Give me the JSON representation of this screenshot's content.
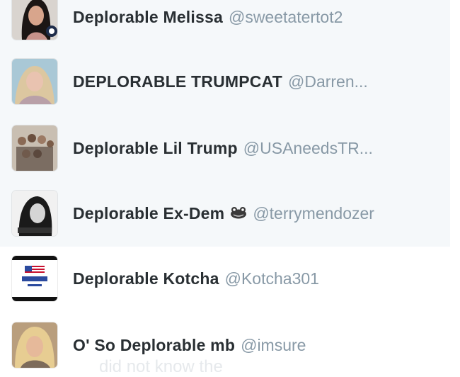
{
  "accounts": [
    {
      "name": "Deplorable Melissa",
      "handle": "@sweetatertot2",
      "avatar": "portrait-dark-hair-avatar"
    },
    {
      "name": "DEPLORABLE TRUMPCAT",
      "handle": "@Darren...",
      "avatar": "portrait-blonde-avatar"
    },
    {
      "name": "Deplorable Lil Trump",
      "handle": "@USAneedsTR...",
      "avatar": "family-group-avatar"
    },
    {
      "name": "Deplorable Ex-Dem",
      "handle": "@terrymendozer",
      "emoji": "frog-icon",
      "avatar": "portrait-bw-avatar"
    },
    {
      "name": "Deplorable Kotcha",
      "handle": "@Kotcha301",
      "avatar": "trump-logo-avatar"
    },
    {
      "name": "O' So Deplorable mb",
      "handle": "@imsure",
      "avatar": "portrait-blonde-avatar"
    }
  ],
  "faded_text": "did not know the",
  "colors": {
    "name": "#292f33",
    "handle": "#8899a6",
    "panel": "#f5f8fa"
  }
}
